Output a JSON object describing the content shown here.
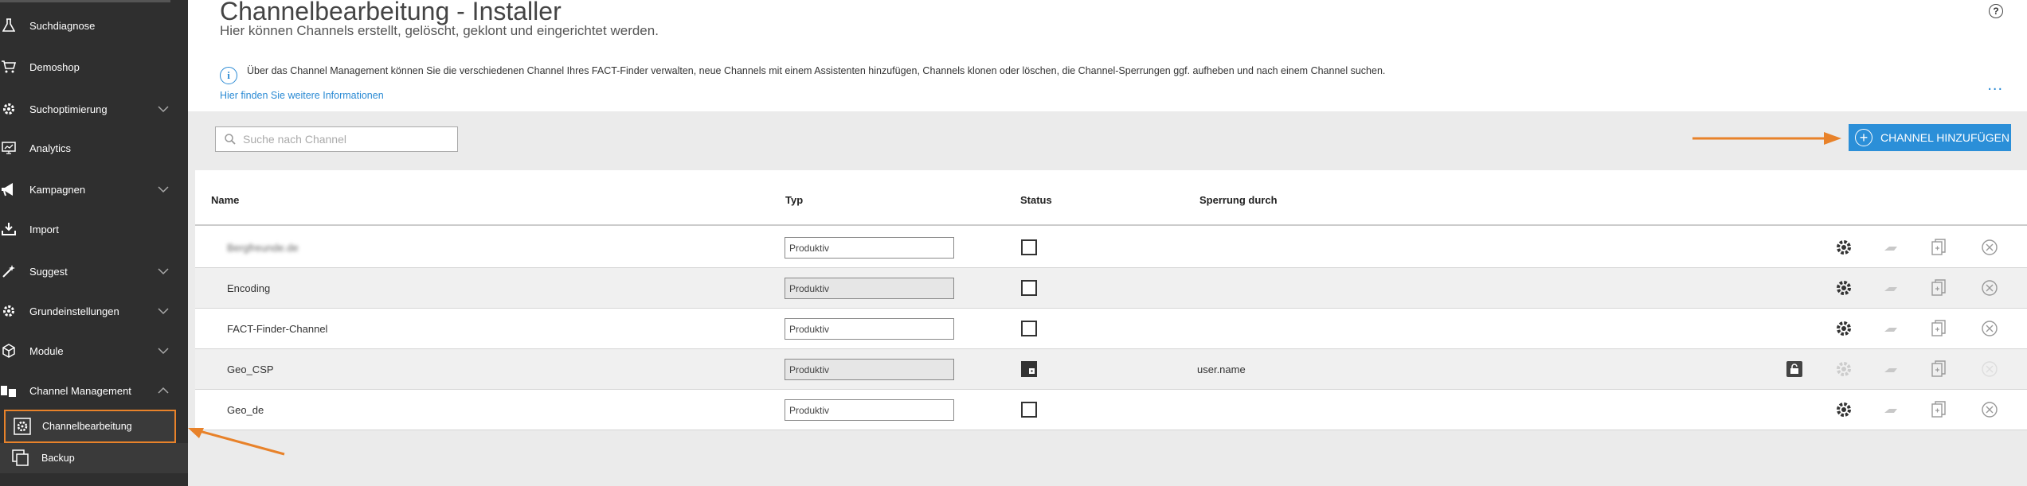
{
  "sidebar": {
    "items": [
      {
        "label": "Suchdiagnose",
        "icon": "flask-icon"
      },
      {
        "label": "Demoshop",
        "icon": "cart-icon"
      },
      {
        "label": "Suchoptimierung",
        "icon": "gear-icon",
        "expandable": true
      },
      {
        "label": "Analytics",
        "icon": "chart-icon"
      },
      {
        "label": "Kampagnen",
        "icon": "megaphone-icon",
        "expandable": true
      },
      {
        "label": "Import",
        "icon": "import-icon"
      },
      {
        "label": "Suggest",
        "icon": "suggest-icon",
        "expandable": true
      },
      {
        "label": "Grundeinstellungen",
        "icon": "gear-icon",
        "expandable": true
      },
      {
        "label": "Module",
        "icon": "box-icon",
        "expandable": true
      },
      {
        "label": "Channel Management",
        "icon": "channel-icon",
        "expanded": true
      }
    ],
    "subitems": [
      {
        "label": "Channelbearbeitung",
        "icon": "channel-edit-icon",
        "active": true
      },
      {
        "label": "Backup",
        "icon": "backup-icon"
      }
    ]
  },
  "header": {
    "title": "Channelbearbeitung - Installer",
    "subtitle": "Hier können Channels erstellt, gelöscht, geklont und eingerichtet werden.",
    "help": "?"
  },
  "info": {
    "text": "Über das Channel Management können Sie die verschiedenen Channel Ihres FACT-Finder verwalten, neue Channels mit einem Assistenten hinzufügen, Channels klonen oder löschen, die Channel-Sperrungen ggf. aufheben und nach einem Channel suchen.",
    "link": "Hier finden Sie weitere Informationen",
    "more": "..."
  },
  "toolbar": {
    "search_placeholder": "Suche nach Channel",
    "add_label": "CHANNEL HINZUFÜGEN"
  },
  "table": {
    "columns": [
      "Name",
      "Typ",
      "Status",
      "Sperrung durch"
    ],
    "rows": [
      {
        "name": "Bergfreunde.de",
        "typ": "Produktiv",
        "status": "unlocked",
        "sperrung": "",
        "blurred": true
      },
      {
        "name": "Encoding",
        "typ": "Produktiv",
        "status": "unlocked",
        "sperrung": ""
      },
      {
        "name": "FACT-Finder-Channel",
        "typ": "Produktiv",
        "status": "unlocked",
        "sperrung": ""
      },
      {
        "name": "Geo_CSP",
        "typ": "Produktiv",
        "status": "locked",
        "sperrung": "user.name"
      },
      {
        "name": "Geo_de",
        "typ": "Produktiv",
        "status": "unlocked",
        "sperrung": ""
      }
    ]
  },
  "colors": {
    "sidebar_bg": "#2f2f2f",
    "accent_blue": "#2b8fd8",
    "highlight_orange": "#e8822a"
  }
}
